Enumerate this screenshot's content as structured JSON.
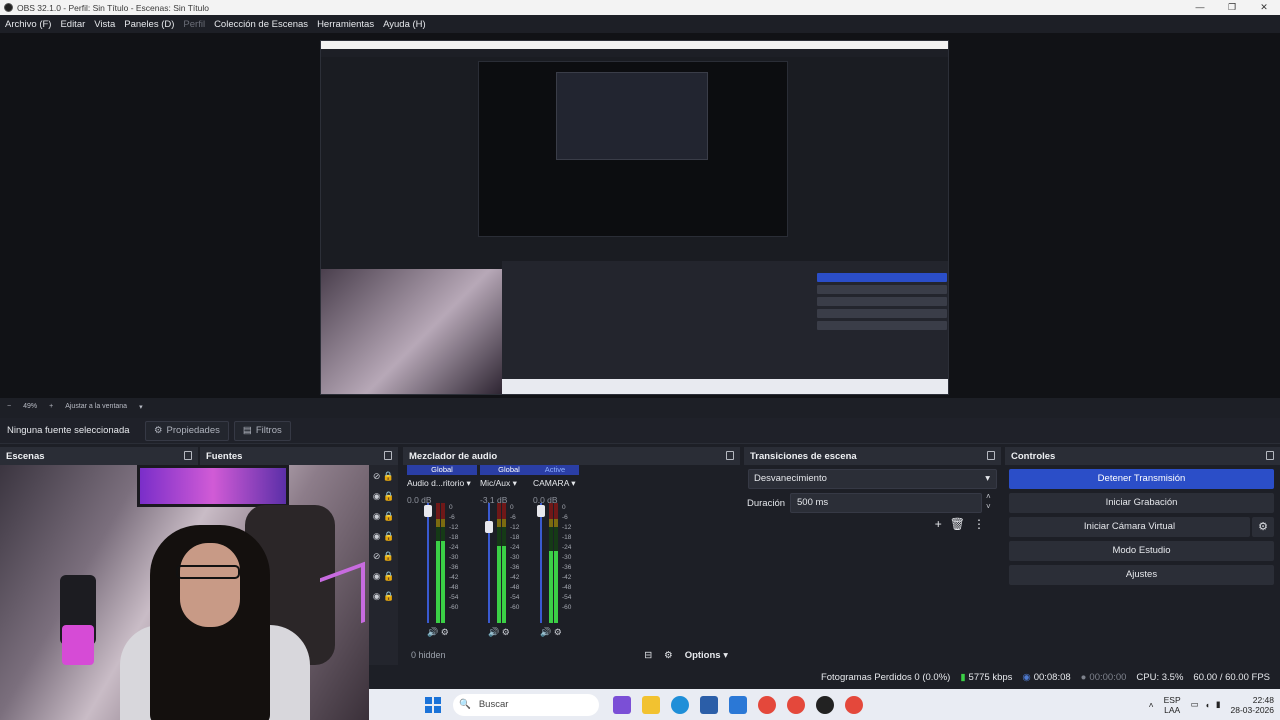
{
  "window": {
    "title": "OBS 32.1.0 - Perfil: Sin Título - Escenas: Sin Título",
    "controls": [
      "—",
      "❐",
      "✕"
    ]
  },
  "menu": [
    "Archivo (F)",
    "Editar",
    "Vista",
    "Paneles (D)",
    "Perfil",
    "Colección de Escenas",
    "Herramientas",
    "Ayuda (H)"
  ],
  "zoom": {
    "minus": "−",
    "value": "49%",
    "plus": "+",
    "fit": "Ajustar a la ventana"
  },
  "source_bar": {
    "none": "Ninguna fuente seleccionada",
    "properties": "Propiedades",
    "filters": "Filtros"
  },
  "panels": {
    "scenes": "Escenas",
    "sources": "Fuentes",
    "mixer": "Mezclador de audio",
    "transitions": "Transiciones de escena",
    "controls": "Controles"
  },
  "mixer": {
    "channels": [
      {
        "tag": "Global",
        "name": "Audio d...ritorio",
        "db": "0.0 dB",
        "level": 0.85
      },
      {
        "tag": "Global",
        "name": "Mic/Aux",
        "db": "-3.1 dB",
        "level": 0.8
      },
      {
        "tag": "Active",
        "name": "CAMARA",
        "db": "0.0 dB",
        "level": 0.75
      }
    ],
    "scale": [
      "0",
      "-6",
      "-12",
      "-18",
      "-24",
      "-30",
      "-36",
      "-42",
      "-48",
      "-54",
      "-60"
    ],
    "hidden": "0 hidden",
    "options": "Options"
  },
  "transitions": {
    "selected": "Desvanecimiento",
    "duration_label": "Duración",
    "duration": "500 ms"
  },
  "controls": {
    "stop_stream": "Detener Transmisión",
    "start_record": "Iniciar Grabación",
    "start_vcam": "Iniciar Cámara Virtual",
    "studio": "Modo Estudio",
    "settings": "Ajustes"
  },
  "status": {
    "dropped": "Fotogramas Perdidos 0 (0.0%)",
    "kbps": "5775 kbps",
    "stream_time": "00:08:08",
    "rec_time": "00:00:00",
    "cpu": "CPU: 3.5%",
    "fps": "60.00 / 60.00 FPS"
  },
  "taskbar": {
    "search": "Buscar",
    "lang": "ESP",
    "region": "LAA",
    "time": "22:48",
    "date": "28-03-2026"
  },
  "colors": {
    "accent": "#2b4ec8",
    "meter_green": "#3bd046"
  }
}
